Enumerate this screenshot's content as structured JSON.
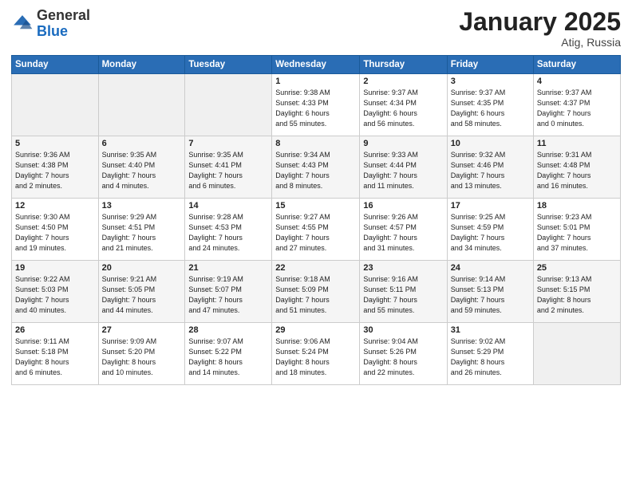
{
  "header": {
    "logo_general": "General",
    "logo_blue": "Blue",
    "month_title": "January 2025",
    "location": "Atig, Russia"
  },
  "weekdays": [
    "Sunday",
    "Monday",
    "Tuesday",
    "Wednesday",
    "Thursday",
    "Friday",
    "Saturday"
  ],
  "weeks": [
    [
      {
        "day": "",
        "info": ""
      },
      {
        "day": "",
        "info": ""
      },
      {
        "day": "",
        "info": ""
      },
      {
        "day": "1",
        "info": "Sunrise: 9:38 AM\nSunset: 4:33 PM\nDaylight: 6 hours\nand 55 minutes."
      },
      {
        "day": "2",
        "info": "Sunrise: 9:37 AM\nSunset: 4:34 PM\nDaylight: 6 hours\nand 56 minutes."
      },
      {
        "day": "3",
        "info": "Sunrise: 9:37 AM\nSunset: 4:35 PM\nDaylight: 6 hours\nand 58 minutes."
      },
      {
        "day": "4",
        "info": "Sunrise: 9:37 AM\nSunset: 4:37 PM\nDaylight: 7 hours\nand 0 minutes."
      }
    ],
    [
      {
        "day": "5",
        "info": "Sunrise: 9:36 AM\nSunset: 4:38 PM\nDaylight: 7 hours\nand 2 minutes."
      },
      {
        "day": "6",
        "info": "Sunrise: 9:35 AM\nSunset: 4:40 PM\nDaylight: 7 hours\nand 4 minutes."
      },
      {
        "day": "7",
        "info": "Sunrise: 9:35 AM\nSunset: 4:41 PM\nDaylight: 7 hours\nand 6 minutes."
      },
      {
        "day": "8",
        "info": "Sunrise: 9:34 AM\nSunset: 4:43 PM\nDaylight: 7 hours\nand 8 minutes."
      },
      {
        "day": "9",
        "info": "Sunrise: 9:33 AM\nSunset: 4:44 PM\nDaylight: 7 hours\nand 11 minutes."
      },
      {
        "day": "10",
        "info": "Sunrise: 9:32 AM\nSunset: 4:46 PM\nDaylight: 7 hours\nand 13 minutes."
      },
      {
        "day": "11",
        "info": "Sunrise: 9:31 AM\nSunset: 4:48 PM\nDaylight: 7 hours\nand 16 minutes."
      }
    ],
    [
      {
        "day": "12",
        "info": "Sunrise: 9:30 AM\nSunset: 4:50 PM\nDaylight: 7 hours\nand 19 minutes."
      },
      {
        "day": "13",
        "info": "Sunrise: 9:29 AM\nSunset: 4:51 PM\nDaylight: 7 hours\nand 21 minutes."
      },
      {
        "day": "14",
        "info": "Sunrise: 9:28 AM\nSunset: 4:53 PM\nDaylight: 7 hours\nand 24 minutes."
      },
      {
        "day": "15",
        "info": "Sunrise: 9:27 AM\nSunset: 4:55 PM\nDaylight: 7 hours\nand 27 minutes."
      },
      {
        "day": "16",
        "info": "Sunrise: 9:26 AM\nSunset: 4:57 PM\nDaylight: 7 hours\nand 31 minutes."
      },
      {
        "day": "17",
        "info": "Sunrise: 9:25 AM\nSunset: 4:59 PM\nDaylight: 7 hours\nand 34 minutes."
      },
      {
        "day": "18",
        "info": "Sunrise: 9:23 AM\nSunset: 5:01 PM\nDaylight: 7 hours\nand 37 minutes."
      }
    ],
    [
      {
        "day": "19",
        "info": "Sunrise: 9:22 AM\nSunset: 5:03 PM\nDaylight: 7 hours\nand 40 minutes."
      },
      {
        "day": "20",
        "info": "Sunrise: 9:21 AM\nSunset: 5:05 PM\nDaylight: 7 hours\nand 44 minutes."
      },
      {
        "day": "21",
        "info": "Sunrise: 9:19 AM\nSunset: 5:07 PM\nDaylight: 7 hours\nand 47 minutes."
      },
      {
        "day": "22",
        "info": "Sunrise: 9:18 AM\nSunset: 5:09 PM\nDaylight: 7 hours\nand 51 minutes."
      },
      {
        "day": "23",
        "info": "Sunrise: 9:16 AM\nSunset: 5:11 PM\nDaylight: 7 hours\nand 55 minutes."
      },
      {
        "day": "24",
        "info": "Sunrise: 9:14 AM\nSunset: 5:13 PM\nDaylight: 7 hours\nand 59 minutes."
      },
      {
        "day": "25",
        "info": "Sunrise: 9:13 AM\nSunset: 5:15 PM\nDaylight: 8 hours\nand 2 minutes."
      }
    ],
    [
      {
        "day": "26",
        "info": "Sunrise: 9:11 AM\nSunset: 5:18 PM\nDaylight: 8 hours\nand 6 minutes."
      },
      {
        "day": "27",
        "info": "Sunrise: 9:09 AM\nSunset: 5:20 PM\nDaylight: 8 hours\nand 10 minutes."
      },
      {
        "day": "28",
        "info": "Sunrise: 9:07 AM\nSunset: 5:22 PM\nDaylight: 8 hours\nand 14 minutes."
      },
      {
        "day": "29",
        "info": "Sunrise: 9:06 AM\nSunset: 5:24 PM\nDaylight: 8 hours\nand 18 minutes."
      },
      {
        "day": "30",
        "info": "Sunrise: 9:04 AM\nSunset: 5:26 PM\nDaylight: 8 hours\nand 22 minutes."
      },
      {
        "day": "31",
        "info": "Sunrise: 9:02 AM\nSunset: 5:29 PM\nDaylight: 8 hours\nand 26 minutes."
      },
      {
        "day": "",
        "info": ""
      }
    ]
  ]
}
